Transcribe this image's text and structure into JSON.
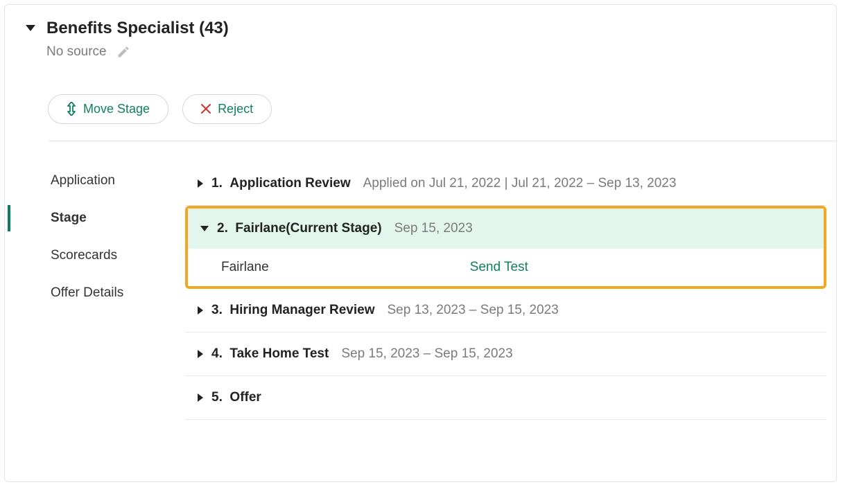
{
  "header": {
    "title": "Benefits Specialist (43)",
    "source_label": "No source"
  },
  "actions": {
    "move_stage": "Move Stage",
    "reject": "Reject"
  },
  "sidebar": {
    "items": [
      {
        "label": "Application",
        "active": false
      },
      {
        "label": "Stage",
        "active": true
      },
      {
        "label": "Scorecards",
        "active": false
      },
      {
        "label": "Offer Details",
        "active": false
      }
    ]
  },
  "stages": [
    {
      "num": "1.",
      "name": "Application Review",
      "meta": "Applied on Jul 21, 2022 | Jul 21, 2022 – Sep 13, 2023",
      "expanded": false,
      "highlighted": false
    },
    {
      "num": "2.",
      "name": "Fairlane",
      "suffix": "(Current Stage)",
      "meta": "Sep 15, 2023",
      "expanded": true,
      "highlighted": true,
      "subitems": [
        {
          "name": "Fairlane",
          "action": "Send Test"
        }
      ]
    },
    {
      "num": "3.",
      "name": "Hiring Manager Review",
      "meta": "Sep 13, 2023 – Sep 15, 2023",
      "expanded": false,
      "highlighted": false
    },
    {
      "num": "4.",
      "name": "Take Home Test",
      "meta": "Sep 15, 2023 – Sep 15, 2023",
      "expanded": false,
      "highlighted": false
    },
    {
      "num": "5.",
      "name": "Offer",
      "meta": "",
      "expanded": false,
      "highlighted": false
    }
  ]
}
